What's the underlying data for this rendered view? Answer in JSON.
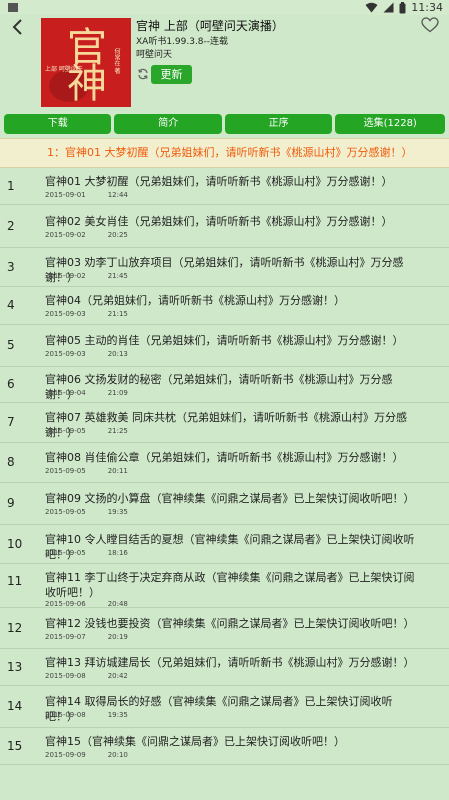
{
  "status_bar": {
    "time": "11:34",
    "icons": [
      "square-icon",
      "wifi-icon",
      "signal-icon",
      "battery-icon"
    ]
  },
  "book": {
    "title": "官神 上部（呵壁问天演播）",
    "app_version": "XA听书1.99.3.8--连载",
    "narrator": "呵壁问天",
    "cover_title": "官神",
    "cover_author": "何常在 著",
    "cover_subtitle": "上部 呵壁问天"
  },
  "actions": {
    "update_label": "更新"
  },
  "tabs": [
    "下载",
    "简介",
    "正序",
    "选集(1228)"
  ],
  "now_playing": "1：官神01 大梦初醒（兄弟姐妹们，请听听新书《桃源山村》万分感谢！）",
  "chapters": [
    {
      "num": "1",
      "title": "官神01 大梦初醒（兄弟姐妹们，请听听新书《桃源山村》万分感谢！）",
      "date": "2015-09-01",
      "duration": "12:44"
    },
    {
      "num": "2",
      "title": "官神02 美女肖佳（兄弟姐妹们，请听听新书《桃源山村》万分感谢！）",
      "date": "2015-09-02",
      "duration": "20:25"
    },
    {
      "num": "3",
      "title": "官神03 劝李丁山放弃项目（兄弟姐妹们，请听听新书《桃源山村》万分感谢！）",
      "date": "2015-09-02",
      "duration": "21:45"
    },
    {
      "num": "4",
      "title": "官神04（兄弟姐妹们，请听听新书《桃源山村》万分感谢！）",
      "date": "2015-09-03",
      "duration": "21:15"
    },
    {
      "num": "5",
      "title": "官神05 主动的肖佳（兄弟姐妹们，请听听新书《桃源山村》万分感谢！）",
      "date": "2015-09-03",
      "duration": "20:13"
    },
    {
      "num": "6",
      "title": "官神06 文扬发财的秘密（兄弟姐妹们，请听听新书《桃源山村》万分感谢！）",
      "date": "2015-09-04",
      "duration": "21:09"
    },
    {
      "num": "7",
      "title": "官神07 英雄救美 同床共枕（兄弟姐妹们，请听听新书《桃源山村》万分感谢！）",
      "date": "2015-09-05",
      "duration": "21:25"
    },
    {
      "num": "8",
      "title": "官神08 肖佳偷公章（兄弟姐妹们，请听听新书《桃源山村》万分感谢！）",
      "date": "2015-09-05",
      "duration": "20:11"
    },
    {
      "num": "9",
      "title": "官神09 文扬的小算盘（官神续集《问鼎之谋局者》已上架快订阅收听吧！）",
      "date": "2015-09-05",
      "duration": "19:35"
    },
    {
      "num": "10",
      "title": "官神10 令人瞠目结舌的夏想（官神续集《问鼎之谋局者》已上架快订阅收听吧！）",
      "date": "2015-09-05",
      "duration": "18:16"
    },
    {
      "num": "11",
      "title": "官神11 李丁山终于决定弃商从政（官神续集《问鼎之谋局者》已上架快订阅收听吧！）",
      "date": "2015-09-06",
      "duration": "20:48"
    },
    {
      "num": "12",
      "title": "官神12 没钱也要投资（官神续集《问鼎之谋局者》已上架快订阅收听吧！）",
      "date": "2015-09-07",
      "duration": "20:19"
    },
    {
      "num": "13",
      "title": "官神13 拜访城建局长（兄弟姐妹们，请听听新书《桃源山村》万分感谢！）",
      "date": "2015-09-08",
      "duration": "20:42"
    },
    {
      "num": "14",
      "title": "官神14 取得局长的好感（官神续集《问鼎之谋局者》已上架快订阅收听吧！）",
      "date": "2015-09-08",
      "duration": "19:35"
    },
    {
      "num": "15",
      "title": "官神15（官神续集《问鼎之谋局者》已上架快订阅收听吧！）",
      "date": "2015-09-09",
      "duration": "20:10"
    }
  ],
  "colors": {
    "background": "#cfe8c9",
    "accent_green": "#24a524",
    "now_playing_text": "#f05a0a",
    "now_playing_bg": "#f2efce"
  }
}
